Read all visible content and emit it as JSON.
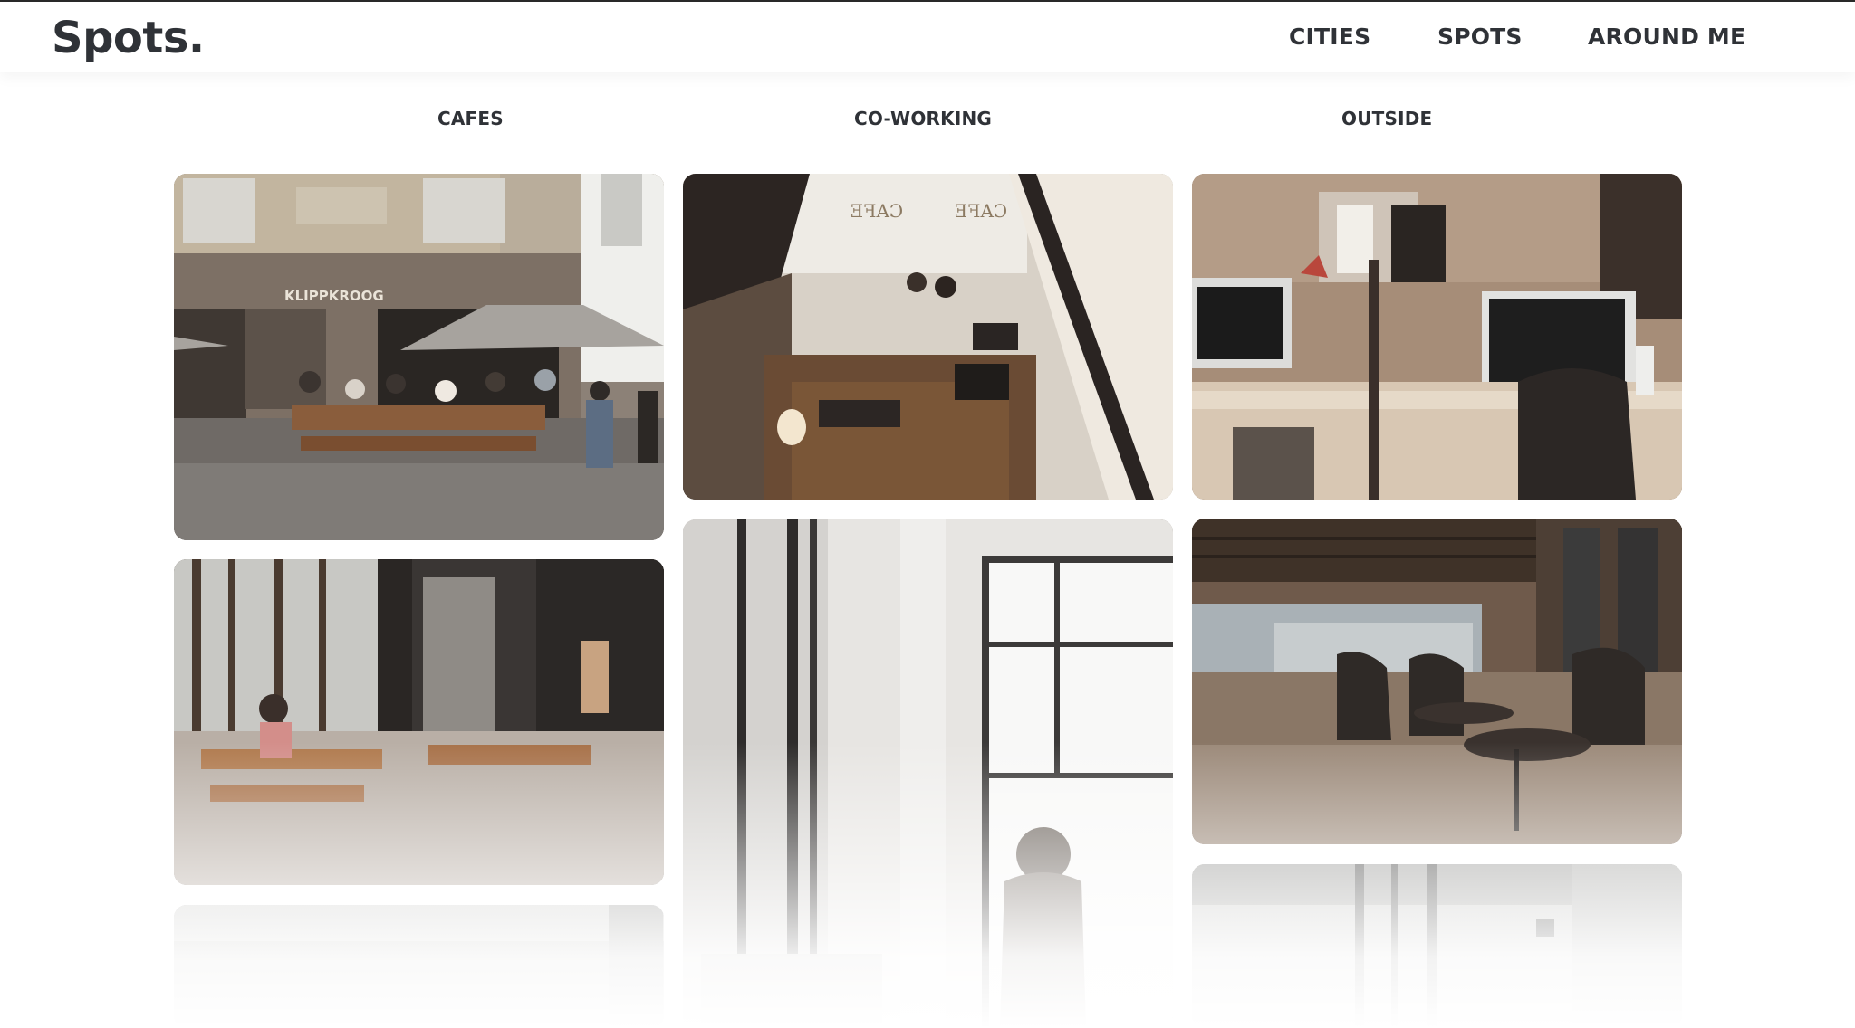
{
  "brand": {
    "logo": "Spots."
  },
  "nav": {
    "cities": "CITIES",
    "spots": "SPOTS",
    "around_me": "AROUND ME"
  },
  "tabs": {
    "cafes": "CAFES",
    "coworking": "CO-WORKING",
    "outside": "OUTSIDE"
  },
  "photos": {
    "cafe_street_sign": "KLIPPKROOG"
  },
  "colors": {
    "text": "#2f3237",
    "background": "#ffffff"
  }
}
